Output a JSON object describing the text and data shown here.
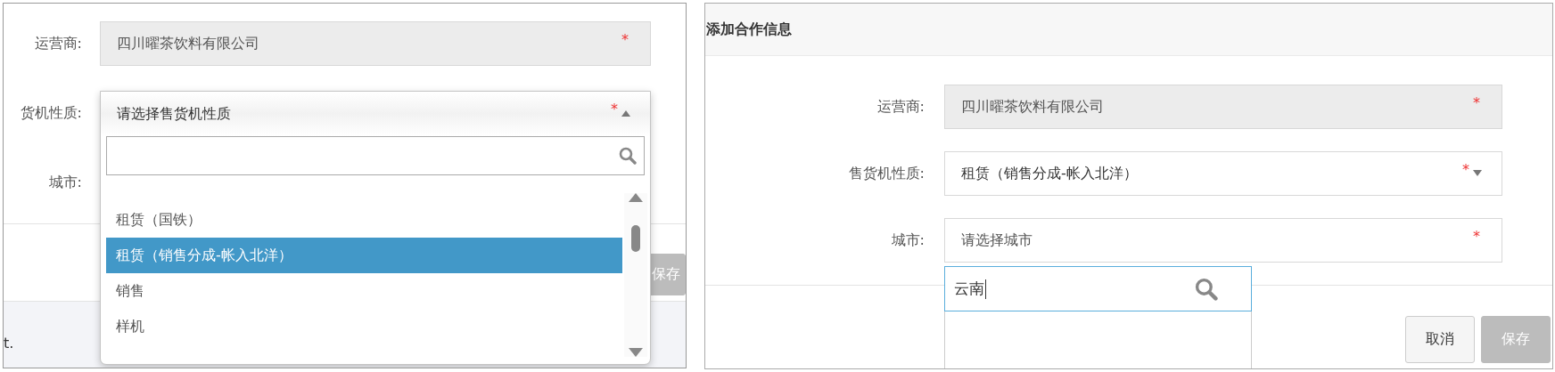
{
  "left_panel": {
    "operator": {
      "label": "运营商:",
      "value": "四川曜茶饮料有限公司",
      "required_mark": "*"
    },
    "machine_type": {
      "label": "货机性质:",
      "placeholder": "请选择售货机性质",
      "required_mark": "*",
      "expanded": true,
      "options": [
        {
          "label": "租赁（国铁）",
          "selected": false
        },
        {
          "label": "租赁（销售分成-帐入北洋）",
          "selected": true
        },
        {
          "label": "销售",
          "selected": false
        },
        {
          "label": "样机",
          "selected": false
        }
      ]
    },
    "city": {
      "label": "城市:"
    },
    "save_button": {
      "label": "保存",
      "disabled": true
    },
    "footer_text": "t."
  },
  "right_panel": {
    "title": "添加合作信息",
    "operator": {
      "label": "运营商:",
      "value": "四川曜茶饮料有限公司",
      "required_mark": "*"
    },
    "machine_type": {
      "label": "售货机性质:",
      "value": "租赁（销售分成-帐入北洋）",
      "required_mark": "*"
    },
    "city": {
      "label": "城市:",
      "placeholder": "请选择城市",
      "required_mark": "*",
      "expanded": true,
      "search": {
        "value": "云南"
      }
    },
    "buttons": [
      {
        "label": "取消",
        "disabled": false
      },
      {
        "label": "保存",
        "disabled": true
      }
    ]
  }
}
